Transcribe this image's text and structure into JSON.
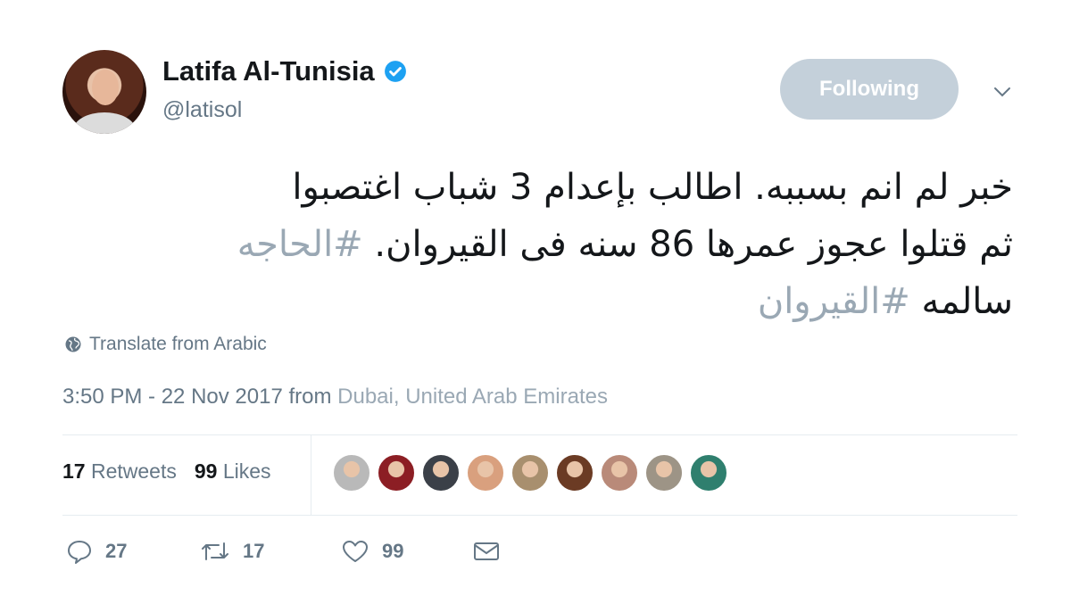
{
  "author": {
    "name": "Latifa Al-Tunisia",
    "handle": "@latisol",
    "verified_icon": "verified-badge-icon"
  },
  "follow_button": {
    "label": "Following"
  },
  "tweet": {
    "lines": [
      {
        "text": "خبر لم انم بسببه. اطالب بإعدام 3 شباب اغتصبوا",
        "hashtag": ""
      },
      {
        "text": "ثم قتلوا عجوز عمرها 86 سنه فى القيروان. ",
        "hashtag": "#الحاجه"
      },
      {
        "text": "سالمه ",
        "hashtag": "#القيروان"
      }
    ]
  },
  "translate": {
    "label": "Translate from Arabic"
  },
  "meta": {
    "time_date": "3:50 PM - 22 Nov 2017 from ",
    "location": "Dubai, United Arab Emirates"
  },
  "stats": {
    "retweets_count": "17",
    "retweets_label": "Retweets",
    "likes_count": "99",
    "likes_label": "Likes"
  },
  "likers": [
    {
      "color": "#b9b9b9"
    },
    {
      "color": "#8c1e24"
    },
    {
      "color": "#3b4048"
    },
    {
      "color": "#d9a07e"
    },
    {
      "color": "#a88f6e"
    },
    {
      "color": "#6b3b24"
    },
    {
      "color": "#b98a79"
    },
    {
      "color": "#9d9486"
    },
    {
      "color": "#2f7f6e"
    }
  ],
  "actions": {
    "replies": "27",
    "retweets": "17",
    "likes": "99"
  },
  "colors": {
    "text_primary": "#14171a",
    "text_secondary": "#657786",
    "hashtag": "#9aa8b4",
    "follow_bg": "#c4d0da",
    "verified": "#1da1f2"
  }
}
